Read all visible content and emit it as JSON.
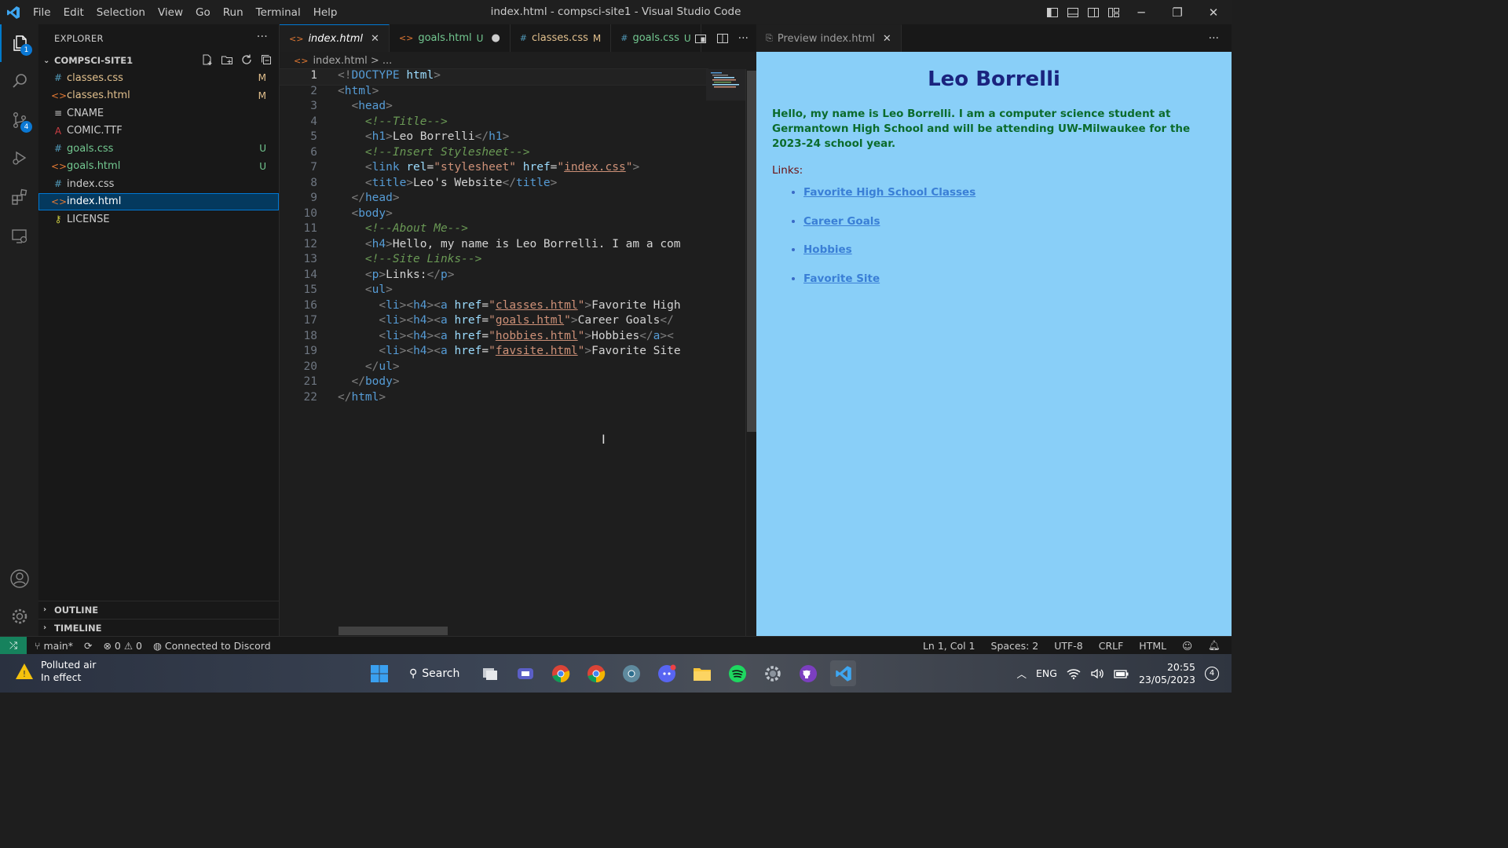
{
  "window": {
    "title": "index.html - compsci-site1 - Visual Studio Code"
  },
  "menu": [
    "File",
    "Edit",
    "Selection",
    "View",
    "Go",
    "Run",
    "Terminal",
    "Help"
  ],
  "activity_bar": {
    "explorer_badge": "1",
    "scm_badge": "4"
  },
  "sidebar": {
    "header": "EXPLORER",
    "folder": "COMPSCI-SITE1",
    "files": [
      {
        "name": "classes.css",
        "icon": "#",
        "status": "M",
        "color": "#e2c08d",
        "icon_color": "#519aba"
      },
      {
        "name": "classes.html",
        "icon": "<>",
        "status": "M",
        "color": "#e2c08d",
        "icon_color": "#e37933"
      },
      {
        "name": "CNAME",
        "icon": "≡",
        "status": "",
        "color": "#cccccc",
        "icon_color": "#cccccc"
      },
      {
        "name": "COMIC.TTF",
        "icon": "A",
        "status": "",
        "color": "#cccccc",
        "icon_color": "#cc3e44"
      },
      {
        "name": "goals.css",
        "icon": "#",
        "status": "U",
        "color": "#73c991",
        "icon_color": "#519aba"
      },
      {
        "name": "goals.html",
        "icon": "<>",
        "status": "U",
        "color": "#73c991",
        "icon_color": "#e37933"
      },
      {
        "name": "index.css",
        "icon": "#",
        "status": "",
        "color": "#cccccc",
        "icon_color": "#519aba"
      },
      {
        "name": "index.html",
        "icon": "<>",
        "status": "",
        "color": "#ffffff",
        "icon_color": "#e37933"
      },
      {
        "name": "LICENSE",
        "icon": "⚷",
        "status": "",
        "color": "#cccccc",
        "icon_color": "#cbcb41"
      }
    ],
    "outline": "OUTLINE",
    "timeline": "TIMELINE"
  },
  "editor": {
    "tabs": [
      {
        "name": "index.html",
        "icon": "<>",
        "status": "",
        "close": "✕"
      },
      {
        "name": "goals.html",
        "icon": "<>",
        "status": "U",
        "close": "●"
      },
      {
        "name": "classes.css",
        "icon": "#",
        "status": "M",
        "close": ""
      },
      {
        "name": "goals.css",
        "icon": "#",
        "status": "U",
        "close": ""
      }
    ],
    "breadcrumb": "index.html > ..."
  },
  "preview": {
    "tab": "Preview index.html",
    "heading": "Leo Borrelli",
    "intro": "Hello, my name is Leo Borrelli. I am a computer science student at Germantown High School and will be attending UW-Milwaukee for the 2023-24 school year.",
    "links_label": "Links:",
    "links": [
      "Favorite High School Classes",
      "Career Goals",
      "Hobbies",
      "Favorite Site"
    ]
  },
  "statusbar": {
    "branch": "main*",
    "problems": "⊗ 0 ⚠ 0",
    "discord": "Connected to Discord",
    "position": "Ln 1, Col 1",
    "spaces": "Spaces: 2",
    "encoding": "UTF-8",
    "eol": "CRLF",
    "language": "HTML"
  },
  "taskbar": {
    "weather_title": "Polluted air",
    "weather_sub": "In effect",
    "search": "Search",
    "lang": "ENG",
    "time": "20:55",
    "date": "23/05/2023",
    "notif": "4"
  }
}
